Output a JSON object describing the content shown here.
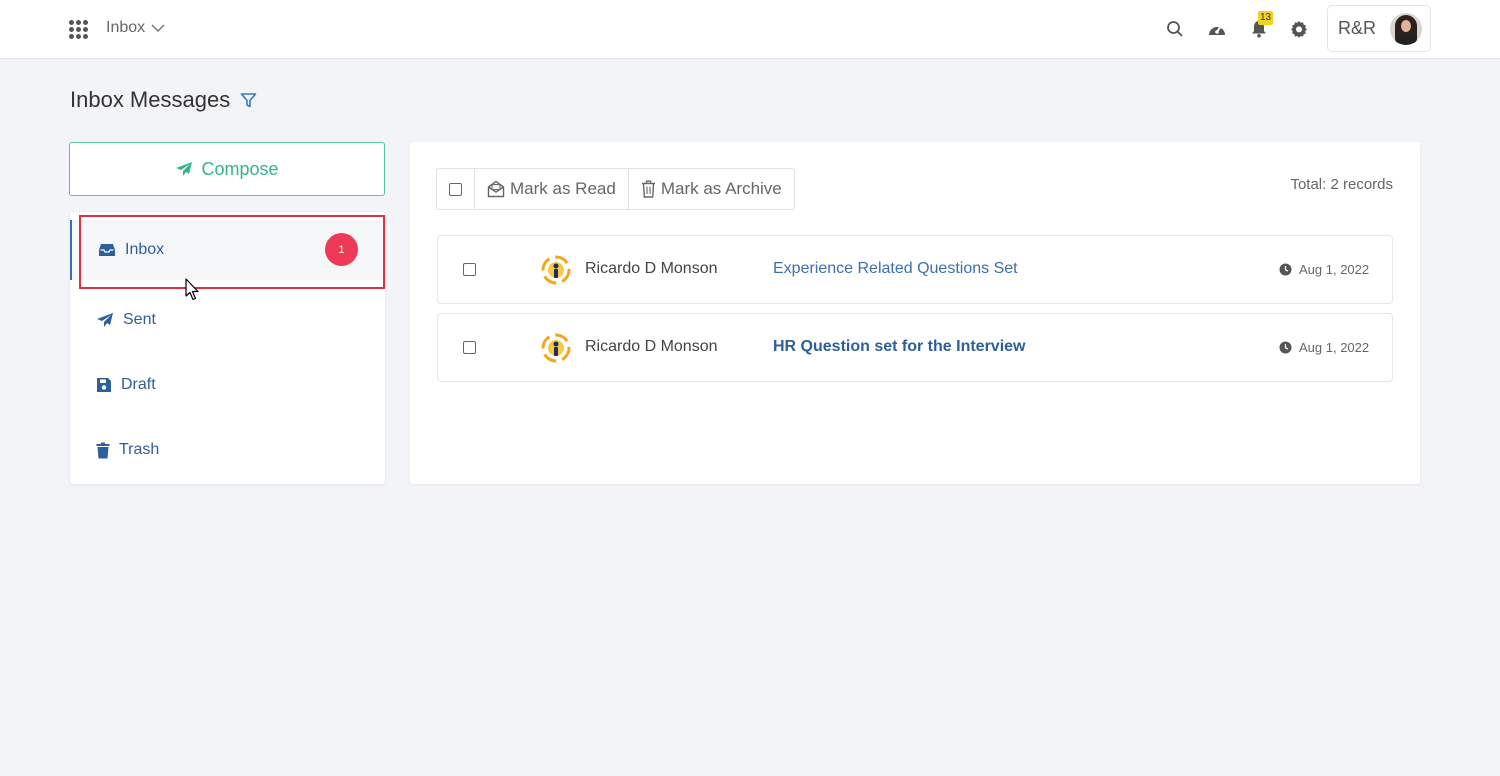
{
  "topbar": {
    "module": "Inbox",
    "notification_count": "13",
    "org": "R&R"
  },
  "page": {
    "title": "Inbox Messages"
  },
  "compose": {
    "label": "Compose"
  },
  "folders": [
    {
      "label": "Inbox",
      "badge": "1",
      "icon": "inbox-icon",
      "active": true
    },
    {
      "label": "Sent",
      "icon": "send-icon"
    },
    {
      "label": "Draft",
      "icon": "save-icon"
    },
    {
      "label": "Trash",
      "icon": "trash-icon"
    }
  ],
  "toolbar": {
    "mark_read": "Mark as Read",
    "mark_archive": "Mark as Archive"
  },
  "total": {
    "label": "Total:",
    "value": "2 records"
  },
  "messages": [
    {
      "sender": "Ricardo D Monson",
      "subject": "Experience Related Questions Set",
      "date": "Aug 1, 2022",
      "unread": false
    },
    {
      "sender": "Ricardo D Monson",
      "subject": "HR Question set for the Interview",
      "date": "Aug 1, 2022",
      "unread": true
    }
  ],
  "colors": {
    "accent_green": "#35b38c",
    "link_blue": "#3a6fb0",
    "badge_red": "#ef3a57",
    "highlight_red": "#e03041",
    "notif_yellow": "#f2d21b"
  }
}
